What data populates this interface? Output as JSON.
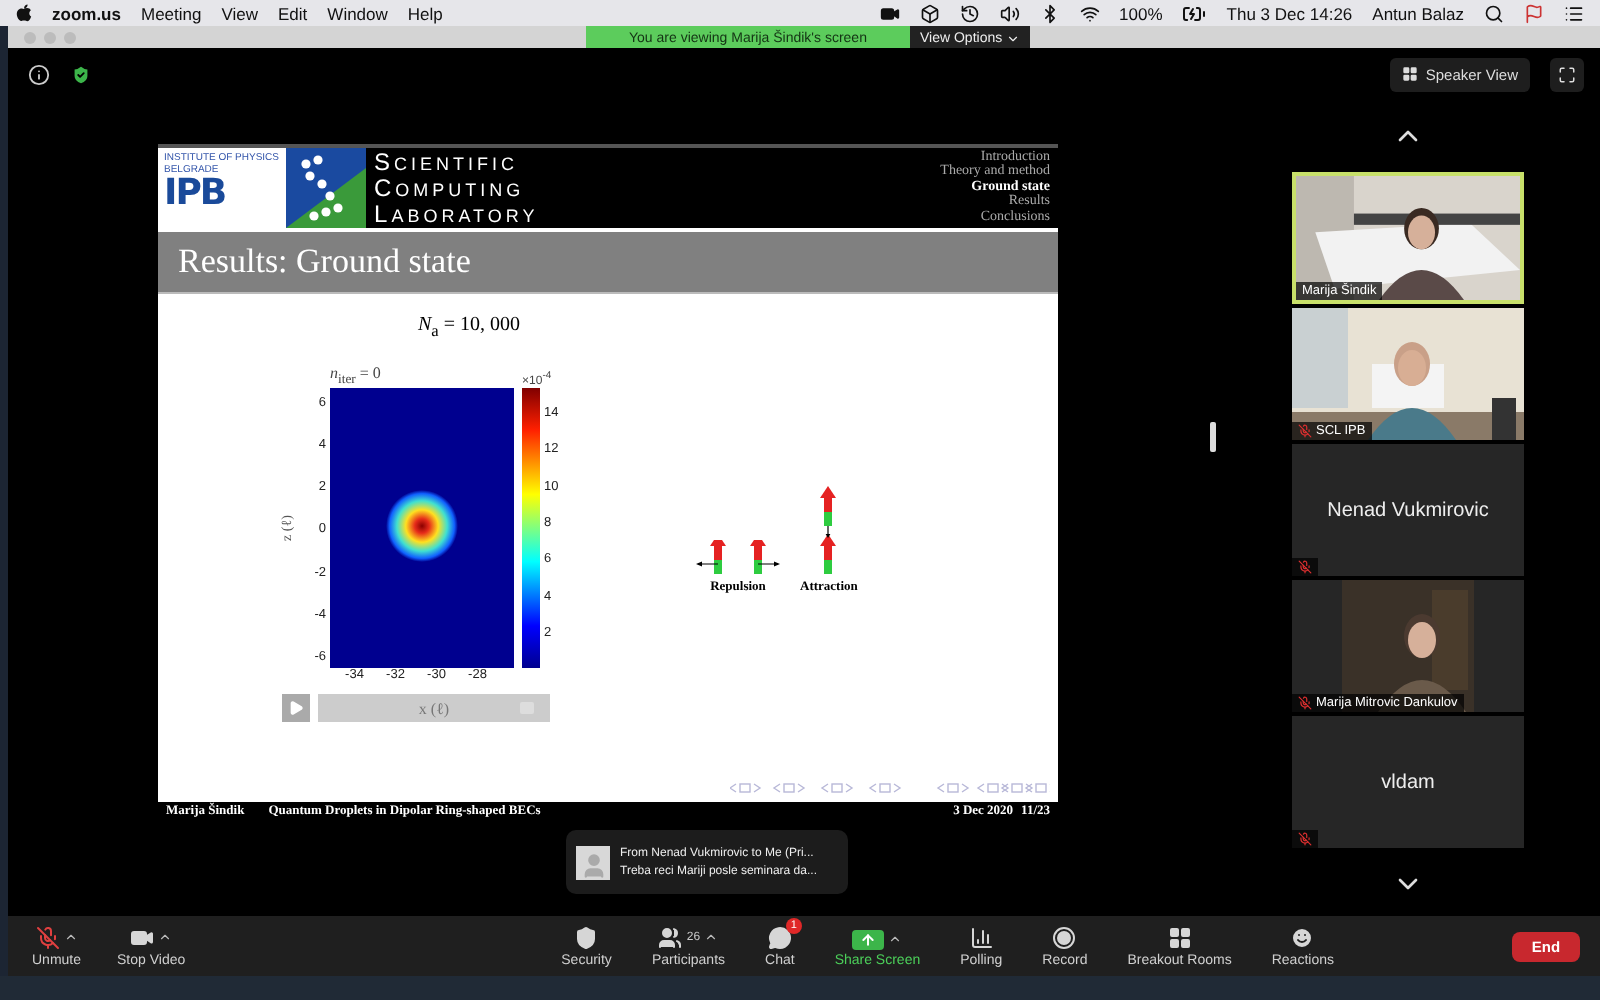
{
  "menu_bar": {
    "app": "zoom.us",
    "menus": [
      "Meeting",
      "View",
      "Edit",
      "Window",
      "Help"
    ],
    "battery": "100%",
    "clock": "Thu 3 Dec  14:26",
    "user": "Antun Balaz"
  },
  "banner": {
    "text": "You are viewing Marija Šindik's screen",
    "options": "View Options"
  },
  "view_button": "Speaker View",
  "slide": {
    "logo": {
      "institute": "INSTITUTE OF PHYSICS",
      "city": "BELGRADE",
      "mark": "IPB"
    },
    "lab": [
      "SCIENTIFIC",
      "COMPUTING",
      "LABORATORY"
    ],
    "sections": [
      {
        "label": "Introduction",
        "selected": false
      },
      {
        "label": "Theory and method",
        "selected": false
      },
      {
        "label": "Ground state",
        "selected": true
      },
      {
        "label": "Results",
        "selected": false
      },
      {
        "label": "Conclusions",
        "selected": false
      }
    ],
    "title": "Results: Ground state",
    "formula": "*N*$_{a}$ = 10, 000",
    "plot": {
      "title": "*n*$_{iter}$ = 0",
      "exponent": "×10$^{-4}$",
      "yticks": [
        "6",
        "4",
        "2",
        "0",
        "-2",
        "-4",
        "-6"
      ],
      "xticks": [
        "-34",
        "-32",
        "-30",
        "-28"
      ],
      "colorbar_ticks": [
        "14",
        "12",
        "10",
        "8",
        "6",
        "4",
        "2"
      ],
      "ylabel": "z (ℓ)",
      "xlabel": "x (ℓ)"
    },
    "player": {
      "level": 0.93
    },
    "diagram": {
      "repulsion": "Repulsion",
      "attraction": "Attraction"
    },
    "footer": {
      "author": "Marija Šindik",
      "talk": "Quantum Droplets in Dipolar Ring-shaped BECs",
      "date": "3 Dec 2020",
      "page": "11/23"
    }
  },
  "participants": [
    {
      "name": "Marija Šindik",
      "kind": "video",
      "speaking": true,
      "muted": false
    },
    {
      "name": "SCL IPB",
      "kind": "video",
      "speaking": false,
      "muted": true
    },
    {
      "name": "Nenad Vukmirovic",
      "kind": "name",
      "speaking": false,
      "muted": true
    },
    {
      "name": "Marija Mitrovic Dankulov",
      "kind": "video",
      "speaking": false,
      "muted": true
    },
    {
      "name": "vldam",
      "kind": "name",
      "speaking": false,
      "muted": true
    }
  ],
  "notification": {
    "title": "From Nenad Vukmirovic to Me (Pri...",
    "message": "Treba reci Mariji posle seminara da..."
  },
  "toolbar": [
    {
      "kind": "mic",
      "label": "Unmute",
      "muted": true,
      "menu": true
    },
    {
      "kind": "video",
      "label": "Stop Video",
      "menu": true
    },
    {
      "kind": "security",
      "label": "Security",
      "menu": false
    },
    {
      "kind": "participants",
      "label": "Participants",
      "count": "26",
      "menu": true
    },
    {
      "kind": "chat",
      "label": "Chat",
      "badge": "1",
      "menu": false
    },
    {
      "kind": "share",
      "label": "Share Screen",
      "menu": true
    },
    {
      "kind": "polling",
      "label": "Polling",
      "menu": false
    },
    {
      "kind": "record",
      "label": "Record",
      "menu": false
    },
    {
      "kind": "rooms",
      "label": "Breakout Rooms",
      "menu": false
    },
    {
      "kind": "reactions",
      "label": "Reactions",
      "menu": false
    }
  ],
  "end": "End"
}
